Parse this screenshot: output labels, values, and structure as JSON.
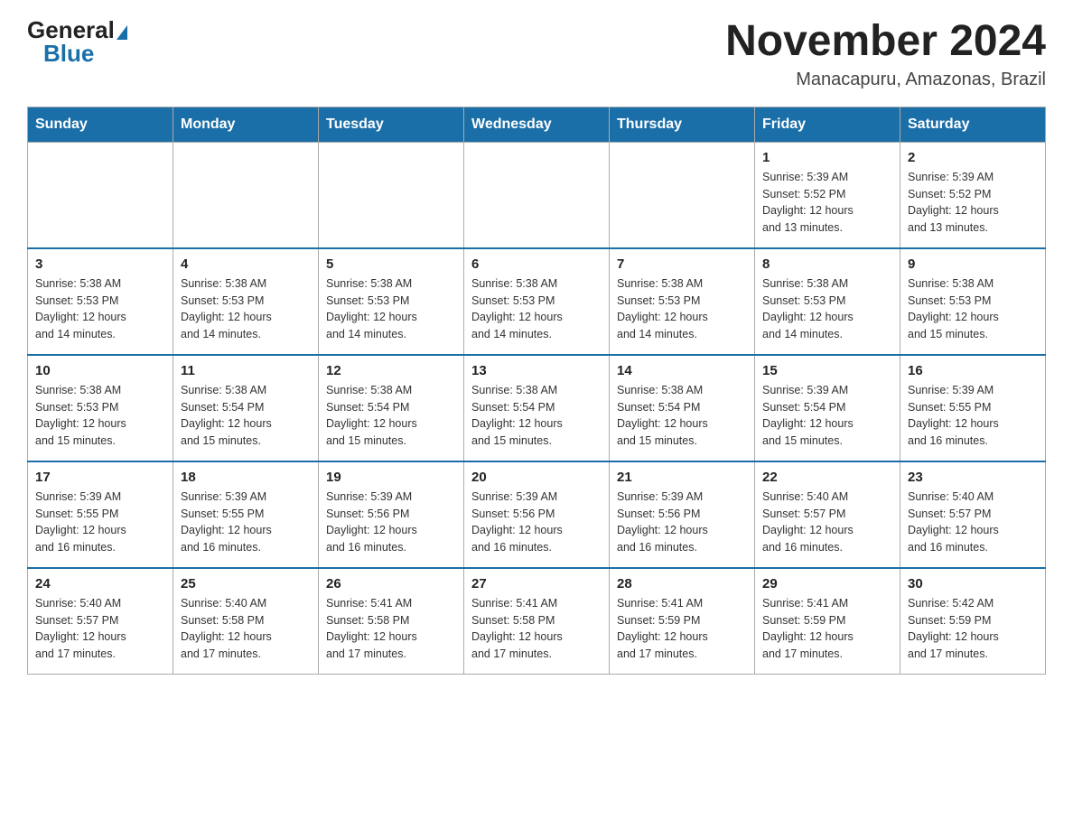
{
  "header": {
    "logo_general": "General",
    "logo_blue": "Blue",
    "month_title": "November 2024",
    "location": "Manacapuru, Amazonas, Brazil"
  },
  "days_of_week": [
    "Sunday",
    "Monday",
    "Tuesday",
    "Wednesday",
    "Thursday",
    "Friday",
    "Saturday"
  ],
  "weeks": [
    [
      {
        "day": "",
        "info": ""
      },
      {
        "day": "",
        "info": ""
      },
      {
        "day": "",
        "info": ""
      },
      {
        "day": "",
        "info": ""
      },
      {
        "day": "",
        "info": ""
      },
      {
        "day": "1",
        "info": "Sunrise: 5:39 AM\nSunset: 5:52 PM\nDaylight: 12 hours\nand 13 minutes."
      },
      {
        "day": "2",
        "info": "Sunrise: 5:39 AM\nSunset: 5:52 PM\nDaylight: 12 hours\nand 13 minutes."
      }
    ],
    [
      {
        "day": "3",
        "info": "Sunrise: 5:38 AM\nSunset: 5:53 PM\nDaylight: 12 hours\nand 14 minutes."
      },
      {
        "day": "4",
        "info": "Sunrise: 5:38 AM\nSunset: 5:53 PM\nDaylight: 12 hours\nand 14 minutes."
      },
      {
        "day": "5",
        "info": "Sunrise: 5:38 AM\nSunset: 5:53 PM\nDaylight: 12 hours\nand 14 minutes."
      },
      {
        "day": "6",
        "info": "Sunrise: 5:38 AM\nSunset: 5:53 PM\nDaylight: 12 hours\nand 14 minutes."
      },
      {
        "day": "7",
        "info": "Sunrise: 5:38 AM\nSunset: 5:53 PM\nDaylight: 12 hours\nand 14 minutes."
      },
      {
        "day": "8",
        "info": "Sunrise: 5:38 AM\nSunset: 5:53 PM\nDaylight: 12 hours\nand 14 minutes."
      },
      {
        "day": "9",
        "info": "Sunrise: 5:38 AM\nSunset: 5:53 PM\nDaylight: 12 hours\nand 15 minutes."
      }
    ],
    [
      {
        "day": "10",
        "info": "Sunrise: 5:38 AM\nSunset: 5:53 PM\nDaylight: 12 hours\nand 15 minutes."
      },
      {
        "day": "11",
        "info": "Sunrise: 5:38 AM\nSunset: 5:54 PM\nDaylight: 12 hours\nand 15 minutes."
      },
      {
        "day": "12",
        "info": "Sunrise: 5:38 AM\nSunset: 5:54 PM\nDaylight: 12 hours\nand 15 minutes."
      },
      {
        "day": "13",
        "info": "Sunrise: 5:38 AM\nSunset: 5:54 PM\nDaylight: 12 hours\nand 15 minutes."
      },
      {
        "day": "14",
        "info": "Sunrise: 5:38 AM\nSunset: 5:54 PM\nDaylight: 12 hours\nand 15 minutes."
      },
      {
        "day": "15",
        "info": "Sunrise: 5:39 AM\nSunset: 5:54 PM\nDaylight: 12 hours\nand 15 minutes."
      },
      {
        "day": "16",
        "info": "Sunrise: 5:39 AM\nSunset: 5:55 PM\nDaylight: 12 hours\nand 16 minutes."
      }
    ],
    [
      {
        "day": "17",
        "info": "Sunrise: 5:39 AM\nSunset: 5:55 PM\nDaylight: 12 hours\nand 16 minutes."
      },
      {
        "day": "18",
        "info": "Sunrise: 5:39 AM\nSunset: 5:55 PM\nDaylight: 12 hours\nand 16 minutes."
      },
      {
        "day": "19",
        "info": "Sunrise: 5:39 AM\nSunset: 5:56 PM\nDaylight: 12 hours\nand 16 minutes."
      },
      {
        "day": "20",
        "info": "Sunrise: 5:39 AM\nSunset: 5:56 PM\nDaylight: 12 hours\nand 16 minutes."
      },
      {
        "day": "21",
        "info": "Sunrise: 5:39 AM\nSunset: 5:56 PM\nDaylight: 12 hours\nand 16 minutes."
      },
      {
        "day": "22",
        "info": "Sunrise: 5:40 AM\nSunset: 5:57 PM\nDaylight: 12 hours\nand 16 minutes."
      },
      {
        "day": "23",
        "info": "Sunrise: 5:40 AM\nSunset: 5:57 PM\nDaylight: 12 hours\nand 16 minutes."
      }
    ],
    [
      {
        "day": "24",
        "info": "Sunrise: 5:40 AM\nSunset: 5:57 PM\nDaylight: 12 hours\nand 17 minutes."
      },
      {
        "day": "25",
        "info": "Sunrise: 5:40 AM\nSunset: 5:58 PM\nDaylight: 12 hours\nand 17 minutes."
      },
      {
        "day": "26",
        "info": "Sunrise: 5:41 AM\nSunset: 5:58 PM\nDaylight: 12 hours\nand 17 minutes."
      },
      {
        "day": "27",
        "info": "Sunrise: 5:41 AM\nSunset: 5:58 PM\nDaylight: 12 hours\nand 17 minutes."
      },
      {
        "day": "28",
        "info": "Sunrise: 5:41 AM\nSunset: 5:59 PM\nDaylight: 12 hours\nand 17 minutes."
      },
      {
        "day": "29",
        "info": "Sunrise: 5:41 AM\nSunset: 5:59 PM\nDaylight: 12 hours\nand 17 minutes."
      },
      {
        "day": "30",
        "info": "Sunrise: 5:42 AM\nSunset: 5:59 PM\nDaylight: 12 hours\nand 17 minutes."
      }
    ]
  ]
}
